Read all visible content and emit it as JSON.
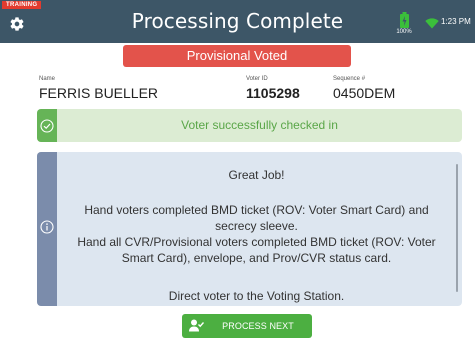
{
  "header": {
    "training_badge": "TRAINING",
    "title": "Processing Complete",
    "battery_label": "100%",
    "time": "1:23 PM",
    "icons": {
      "settings": "gear-icon",
      "battery": "battery-charging-icon",
      "wifi": "wifi-icon"
    }
  },
  "status": {
    "label": "Provisional Voted"
  },
  "voter": {
    "name_label": "Name",
    "name": "FERRIS BUELLER",
    "id_label": "Voter ID",
    "id": "1105298",
    "sequence_label": "Sequence #",
    "sequence": "0450DEM"
  },
  "success": {
    "message": "Voter successfully checked in",
    "icon": "check-circle-icon"
  },
  "info": {
    "icon": "info-circle-icon",
    "heading": "Great Job!",
    "line1": "Hand voters completed BMD ticket (ROV: Voter Smart Card) and secrecy sleeve.",
    "line2": "Hand all CVR/Provisional voters completed BMD ticket (ROV: Voter Smart Card), envelope, and Prov/CVR status card.",
    "line3": "Direct voter to the Voting Station."
  },
  "actions": {
    "process_next": "PROCESS NEXT VOTER",
    "icon": "user-check-icon"
  },
  "colors": {
    "header": "#3d5667",
    "status_red": "#e3534b",
    "success_green": "#66b457",
    "success_bg": "#dcecd3",
    "info_bg": "#dde6f0",
    "info_side": "#7b8cab",
    "button_green": "#4caf41"
  }
}
